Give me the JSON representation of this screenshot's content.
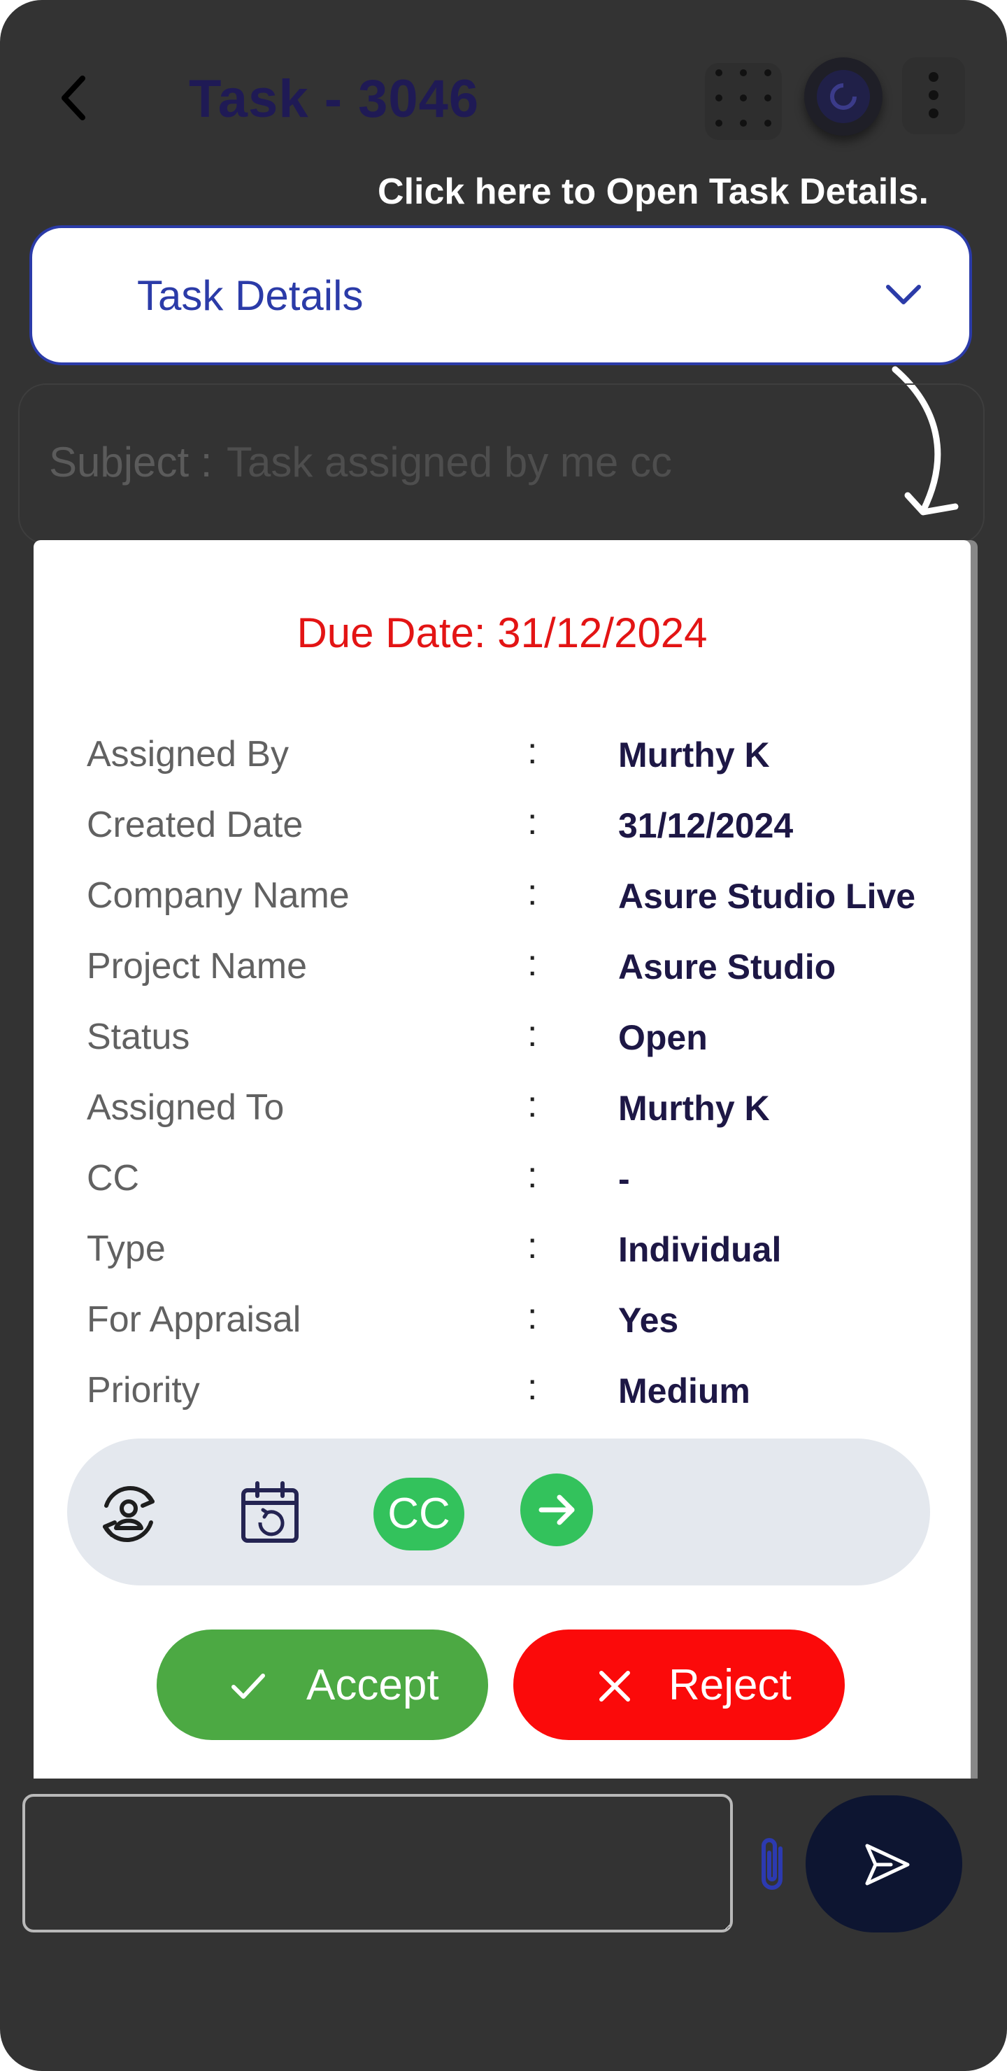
{
  "header": {
    "title": "Task - 3046",
    "back_icon": "chevron-left-icon",
    "grid_icon": "grid-dots-icon",
    "avatar_icon": "user-avatar-icon",
    "menu_icon": "kebab-menu-icon"
  },
  "hint": {
    "text": "Click here to Open Task Details.",
    "arrow_icon": "curved-arrow-down-icon"
  },
  "task_details": {
    "label": "Task Details",
    "chevron_icon": "chevron-down-icon",
    "expanded": true
  },
  "subject": {
    "label": "Subject :",
    "value": "Task assigned by me cc"
  },
  "details_card": {
    "due_date": "Due Date: 31/12/2024",
    "rows": [
      {
        "label": "Assigned By",
        "colon": ":",
        "value": "Murthy K"
      },
      {
        "label": "Created Date",
        "colon": ":",
        "value": "31/12/2024"
      },
      {
        "label": "Company Name",
        "colon": ":",
        "value": "Asure Studio Live"
      },
      {
        "label": "Project Name",
        "colon": ":",
        "value": "Asure Studio"
      },
      {
        "label": "Status",
        "colon": ":",
        "value": "Open"
      },
      {
        "label": "Assigned To",
        "colon": ":",
        "value": "Murthy K"
      },
      {
        "label": "CC",
        "colon": ":",
        "value": "-"
      },
      {
        "label": "Type",
        "colon": ":",
        "value": "Individual"
      },
      {
        "label": "For Appraisal",
        "colon": ":",
        "value": "Yes"
      },
      {
        "label": "Priority",
        "colon": ":",
        "value": "Medium"
      }
    ],
    "actions": {
      "reassign_icon": "reassign-user-icon",
      "calendar_icon": "calendar-refresh-icon",
      "cc_label": "CC",
      "forward_icon": "arrow-right-icon"
    },
    "accept_label": "Accept",
    "reject_label": "Reject"
  },
  "composer": {
    "message_value": "",
    "attach_icon": "paperclip-icon",
    "send_icon": "send-icon"
  },
  "colors": {
    "background": "#333333",
    "accent_blue": "#2b3ba8",
    "title_navy": "#1f1a55",
    "due_red": "#e31414",
    "accept_green": "#4ca943",
    "reject_red": "#fb0a0a",
    "chip_green": "#33c25c",
    "send_navy": "#0d1531"
  }
}
